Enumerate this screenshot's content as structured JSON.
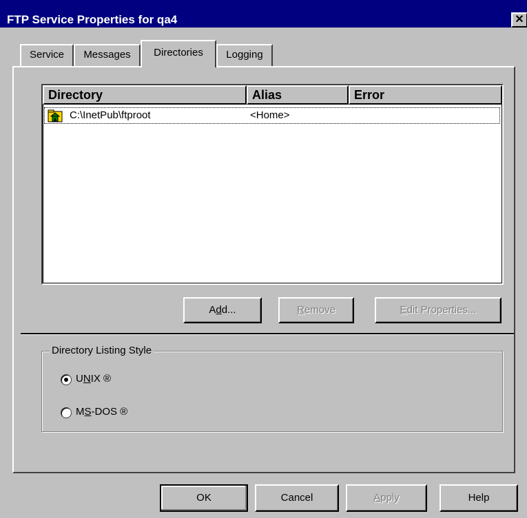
{
  "window": {
    "title": "FTP Service Properties for qa4",
    "close_glyph": "✕"
  },
  "tabs": [
    {
      "label": "Service"
    },
    {
      "label": "Messages"
    },
    {
      "label": "Directories",
      "active": true
    },
    {
      "label": "Logging"
    }
  ],
  "list": {
    "columns": [
      "Directory",
      "Alias",
      "Error"
    ],
    "rows": [
      {
        "directory": "C:\\InetPub\\ftproot",
        "alias": "<Home>",
        "error": "",
        "icon": "folder-home-icon"
      }
    ]
  },
  "list_buttons": {
    "add": {
      "pre": "A",
      "key": "d",
      "post": "d...",
      "disabled": false
    },
    "remove": {
      "pre": "",
      "key": "R",
      "post": "emove",
      "disabled": true
    },
    "edit": {
      "pre": "",
      "key": "E",
      "post": "dit Properties...",
      "disabled": true
    }
  },
  "listing_style": {
    "label": "Directory Listing Style",
    "options": [
      {
        "pre": "U",
        "key": "N",
        "post": "IX ®",
        "selected": true
      },
      {
        "pre": "M",
        "key": "S",
        "post": "-DOS ®",
        "selected": false
      }
    ]
  },
  "dialog_buttons": {
    "ok": {
      "label": "OK",
      "disabled": false
    },
    "cancel": {
      "label": "Cancel",
      "disabled": false
    },
    "apply": {
      "pre": "",
      "key": "A",
      "post": "pply",
      "disabled": true
    },
    "help": {
      "label": "Help",
      "disabled": false
    }
  },
  "colors": {
    "titlebar": "#000080",
    "face": "#c0c0c0",
    "disabled_text": "#808080"
  }
}
